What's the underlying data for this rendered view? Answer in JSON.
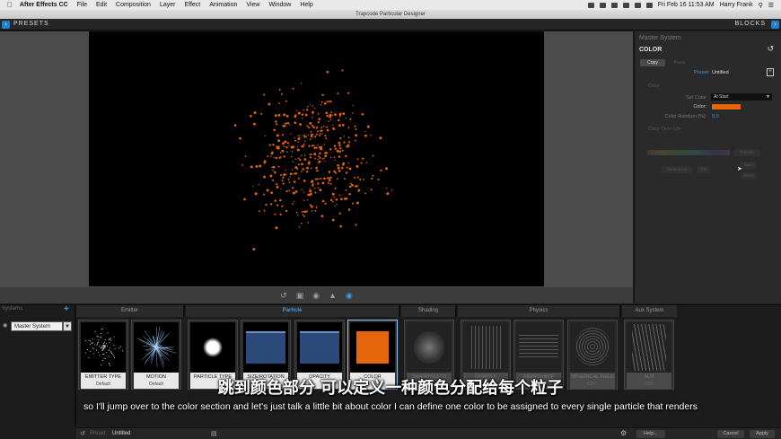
{
  "menubar": {
    "app": "After Effects CC",
    "items": [
      "File",
      "Edit",
      "Composition",
      "Layer",
      "Effect",
      "Animation",
      "View",
      "Window",
      "Help"
    ],
    "datetime": "Fri Feb 16  11:53 AM",
    "user": "Harry Frank"
  },
  "window_title": "Trapcode Particular Designer",
  "topbar": {
    "presets_label": "PRESETS",
    "blocks_label": "BLOCKS"
  },
  "viewport": {
    "particle_color": "#e6640a",
    "particle_count": 420
  },
  "right_panel": {
    "system_name": "Master System",
    "section_title": "COLOR",
    "copy_label": "Copy",
    "paste_label": "Paste",
    "preset_label": "Preset:",
    "preset_value": "Untitled",
    "color_group": "Color",
    "set_color_label": "Set Color",
    "set_color_value": "At Start",
    "color_label": "Color:",
    "color_value": "#e6640a",
    "color_random_label": "Color Random [%]:",
    "color_random_value": "0.0",
    "color_over_life_group": "Color Over Life",
    "presets_btn": "Presets",
    "randomize_btn": "Randomize",
    "fill_btn": "Fill",
    "save_btn": "Save",
    "reset_btn": "Reset"
  },
  "bottom": {
    "systems_label": "Systems",
    "system_item": "Master System",
    "categories": [
      "Emitter",
      "Particle",
      "Shading",
      "Physics",
      "Aux System"
    ],
    "blocks": [
      {
        "title": "EMITTER TYPE",
        "sub": "Default"
      },
      {
        "title": "MOTION",
        "sub": "Default"
      },
      {
        "title": "PARTICLE TYPE",
        "sub": ""
      },
      {
        "title": "SIZE/ROTATION",
        "sub": ""
      },
      {
        "title": "OPACITY",
        "sub": ""
      },
      {
        "title": "COLOR",
        "sub": ""
      },
      {
        "title": "SHADOWLETS",
        "sub": ""
      },
      {
        "title": "GRAVITY",
        "sub": ""
      },
      {
        "title": "AIR/BOUNCE",
        "sub": ""
      },
      {
        "title": "SPHERICAL FIELD",
        "sub": "OFF"
      },
      {
        "title": "AUX",
        "sub": "OFF"
      }
    ]
  },
  "footer": {
    "preset_label": "Preset:",
    "preset_value": "Untitled",
    "help_label": "Help...",
    "cancel_label": "Cancel",
    "apply_label": "Apply"
  },
  "subtitles": {
    "zh": "跳到颜色部分 可以定义一种颜色分配给每个粒子",
    "en": "so I'll jump over to the color section and let's just talk a little bit about color I can define one color to be assigned to every single particle that renders"
  }
}
